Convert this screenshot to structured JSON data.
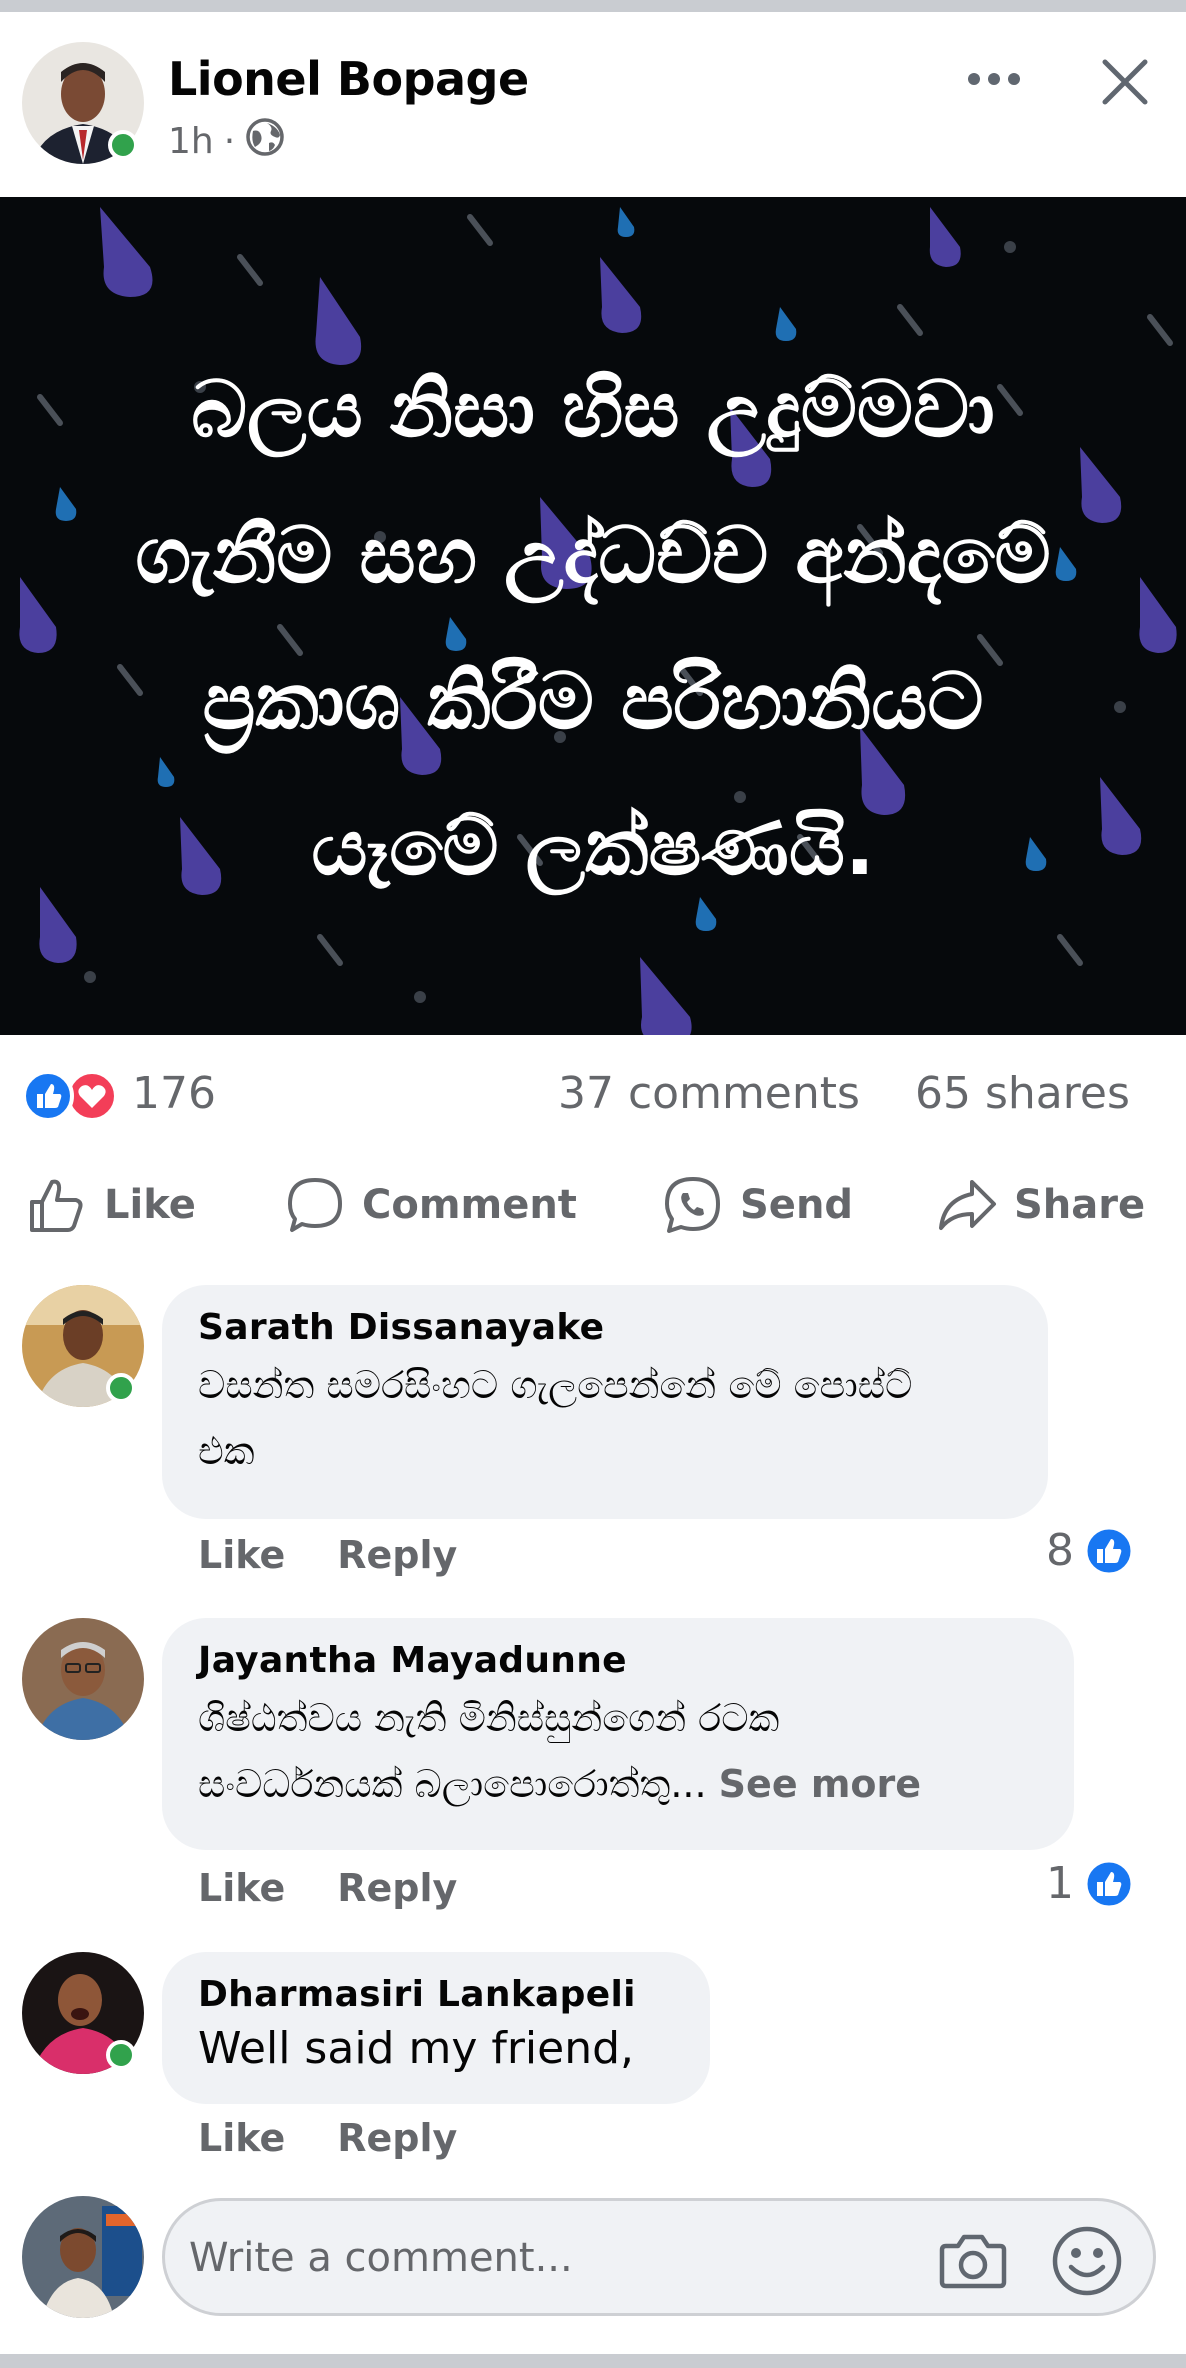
{
  "post": {
    "author": "Lionel Bopage",
    "time": "1h",
    "separator": "·",
    "quote_lines": [
      "බලය නිසා හිස උදුම්මවා",
      "ගැනීම සහ උද්ධච්ච අන්දමේ",
      "ප්‍රකාශ කිරීම පරිහානියට",
      "යෑමේ ලක්ෂණයි."
    ]
  },
  "summary": {
    "reactions": "176",
    "comments": "37 comments",
    "shares": "65 shares"
  },
  "actions": {
    "like": "Like",
    "comment": "Comment",
    "send": "Send",
    "share": "Share"
  },
  "comments": [
    {
      "name": "Sarath Dissanayake",
      "lines": [
        "වසන්ත සමරසිංහට ගැලපෙන්නේ මේ පොස්ට්",
        "එක"
      ],
      "like": "Like",
      "reply": "Reply",
      "likes": "8"
    },
    {
      "name": "Jayantha Mayadunne",
      "lines": [
        "ශිෂ්ඨත්වය නැති මිනිස්සුන්ගෙන් රටක",
        "සංවර්ධනයක් බලාපොරොත්තු..."
      ],
      "see_more": "See more",
      "like": "Like",
      "reply": "Reply",
      "likes": "1"
    },
    {
      "name": "Dharmasiri Lankapeli",
      "lines": [
        "Well said my friend,"
      ],
      "like": "Like",
      "reply": "Reply"
    }
  ],
  "composer": {
    "placeholder": "Write a comment..."
  },
  "colors": {
    "like_blue": "#1877f2",
    "love_red": "#f33e58",
    "online_green": "#31a24c",
    "muted_text": "#65676b",
    "bubble_bg": "#f0f2f5"
  },
  "icons": [
    "more-icon",
    "close-icon",
    "globe-icon",
    "like-icon",
    "comment-icon",
    "send-icon",
    "share-icon",
    "camera-icon",
    "emoji-icon"
  ]
}
